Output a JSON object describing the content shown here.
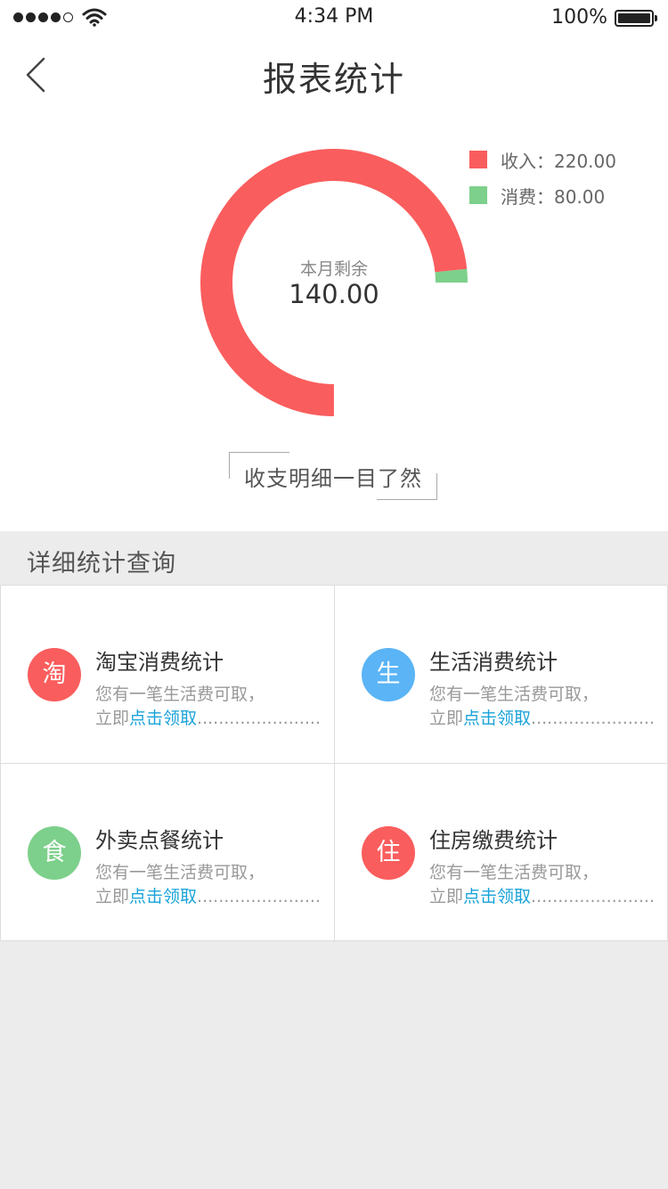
{
  "status_bar": {
    "time": "4:34 PM",
    "battery": "100%"
  },
  "nav": {
    "title": "报表统计"
  },
  "chart_data": {
    "type": "pie",
    "categories": [
      "收入",
      "消费"
    ],
    "values": [
      220.0,
      80.0
    ],
    "colors": [
      "#fa5d5d",
      "#7dd08b"
    ],
    "center_label": "本月剩余",
    "center_value": "140.00",
    "legend_placement": "top-right"
  },
  "legend": [
    {
      "label": "收入：220.00",
      "color": "#fa5d5d"
    },
    {
      "label": "消费：80.00",
      "color": "#7dd08b"
    }
  ],
  "caption": "收支明细一目了然",
  "section": {
    "title": "详细统计查询"
  },
  "cards": [
    {
      "badge": "淘",
      "color": "#fa5d5d",
      "title": "淘宝消费统计",
      "desc": "您有一笔生活费可取，",
      "line2_prefix": "立即",
      "link": "点击领取",
      "dots": "......................................"
    },
    {
      "badge": "生",
      "color": "#5ab4f5",
      "title": "生活消费统计",
      "desc": "您有一笔生活费可取，",
      "line2_prefix": "立即",
      "link": "点击领取",
      "dots": "......................................"
    },
    {
      "badge": "食",
      "color": "#7dd08b",
      "title": "外卖点餐统计",
      "desc": "您有一笔生活费可取，",
      "line2_prefix": "立即",
      "link": "点击领取",
      "dots": "......................................"
    },
    {
      "badge": "住",
      "color": "#fa5d5d",
      "title": "住房缴费统计",
      "desc": "您有一笔生活费可取，",
      "line2_prefix": "立即",
      "link": "点击领取",
      "dots": "......................................"
    }
  ]
}
